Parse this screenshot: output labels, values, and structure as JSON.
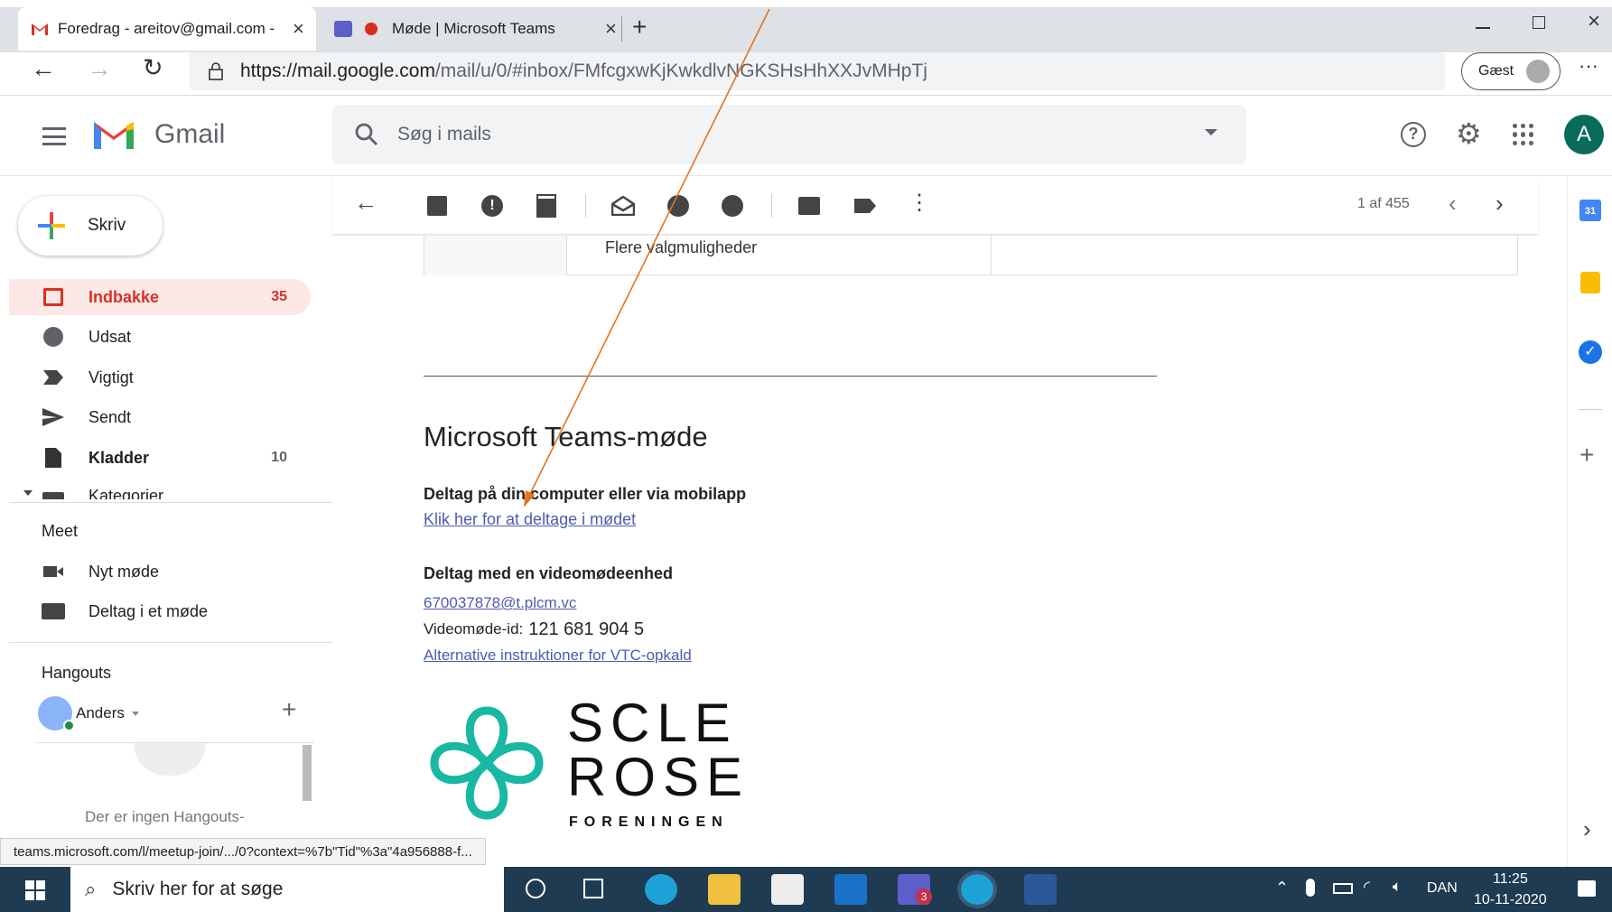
{
  "browser": {
    "tabs": [
      {
        "title": "Foredrag - areitov@gmail.com -",
        "close": "×"
      },
      {
        "title": "Møde | Microsoft Teams",
        "close": "×"
      }
    ],
    "new_tab": "+",
    "url_host": "https://mail.google.com",
    "url_path": "/mail/u/0/#inbox/FMfcgxwKjKwkdlvNGKSHsHhXXJvMHpTj",
    "guest_label": "Gæst",
    "more": "···"
  },
  "gmail": {
    "app_name": "Gmail",
    "search_placeholder": "Søg i mails",
    "avatar_letter": "A",
    "compose_label": "Skriv",
    "nav": [
      {
        "label": "Indbakke",
        "count": "35",
        "icon": "inbox-icon"
      },
      {
        "label": "Udsat",
        "count": "",
        "icon": "clock-icon"
      },
      {
        "label": "Vigtigt",
        "count": "",
        "icon": "important-icon"
      },
      {
        "label": "Sendt",
        "count": "",
        "icon": "send-icon"
      },
      {
        "label": "Kladder",
        "count": "10",
        "icon": "draft-icon"
      },
      {
        "label": "Kategorier",
        "count": "",
        "icon": "label-icon"
      }
    ],
    "meet": {
      "heading": "Meet",
      "new_meeting": "Nyt møde",
      "join_meeting": "Deltag i et møde"
    },
    "hangouts": {
      "heading": "Hangouts",
      "user": "Anders",
      "add": "+",
      "empty_text": "Der er ingen Hangouts-"
    },
    "pager": "1 af 455"
  },
  "email": {
    "more_options": "Flere valgmuligheder",
    "meeting_title": "Microsoft Teams-møde",
    "join_heading": "Deltag på din computer eller via mobilapp",
    "join_link": "Klik her for at deltage i mødet",
    "video_heading": "Deltag med en videomødeenhed",
    "video_address": "670037878@t.plcm.vc",
    "video_id_label": "Videomøde-id:",
    "video_id": "121 681 904 5",
    "vtc_link": "Alternative instruktioner for VTC-opkald",
    "logo_line1": "SCLE",
    "logo_line2": "ROSE",
    "logo_line3": "FORENINGEN"
  },
  "status_link": "teams.microsoft.com/l/meetup-join/.../0?context=%7b\"Tid\"%3a\"4a956888-f...",
  "taskbar": {
    "search_placeholder": "Skriv her for at søge",
    "language": "DAN",
    "time": "11:25",
    "date": "10-11-2020",
    "teams_badge": "3"
  },
  "colors": {
    "accent_red": "#d93025",
    "link": "#4b5bb5",
    "annotation": "#e8731a",
    "taskbar": "#1f3b52"
  }
}
